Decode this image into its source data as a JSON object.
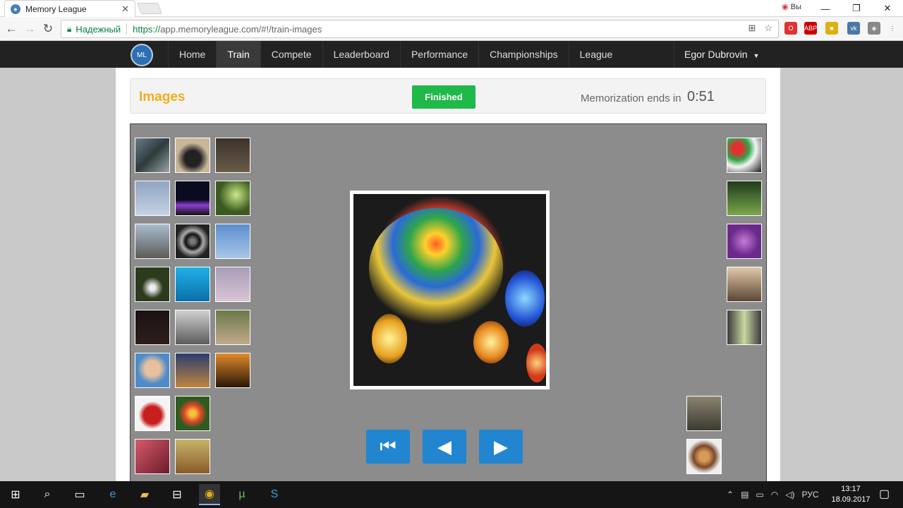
{
  "browser": {
    "tab_title": "Memory League",
    "tab_close": "✕",
    "secure_label": "Надежный",
    "url_proto": "https://",
    "url_rest": "app.memoryleague.com/#!/train-images",
    "tray_label": "Вы",
    "win_min": "—",
    "win_max": "❐",
    "win_close": "✕"
  },
  "site": {
    "nav": {
      "items": [
        {
          "label": "Home"
        },
        {
          "label": "Train",
          "active": true
        },
        {
          "label": "Compete"
        },
        {
          "label": "Leaderboard"
        },
        {
          "label": "Performance"
        },
        {
          "label": "Championships"
        },
        {
          "label": "League"
        }
      ],
      "user": "Egor Dubrovin"
    },
    "header": {
      "title": "Images",
      "status_button": "Finished",
      "timer_label": "Memorization ends in",
      "timer_value": "0:51"
    },
    "controls": {
      "first_icon": "skip-back-icon",
      "prev_icon": "arrow-left-icon",
      "next_icon": "arrow-right-icon"
    }
  },
  "taskbar": {
    "lang": "РУС",
    "time": "13:17",
    "date": "18.09.2017",
    "apps": [
      "windows-start-icon",
      "search-icon",
      "task-view-icon",
      "edge-icon",
      "file-explorer-icon",
      "store-icon",
      "chrome-icon",
      "utorrent-icon",
      "skype-icon"
    ]
  },
  "colors": {
    "accent": "#2185d0",
    "success": "#1fb94a",
    "title": "#f0ad1e",
    "navbar": "#222222"
  }
}
